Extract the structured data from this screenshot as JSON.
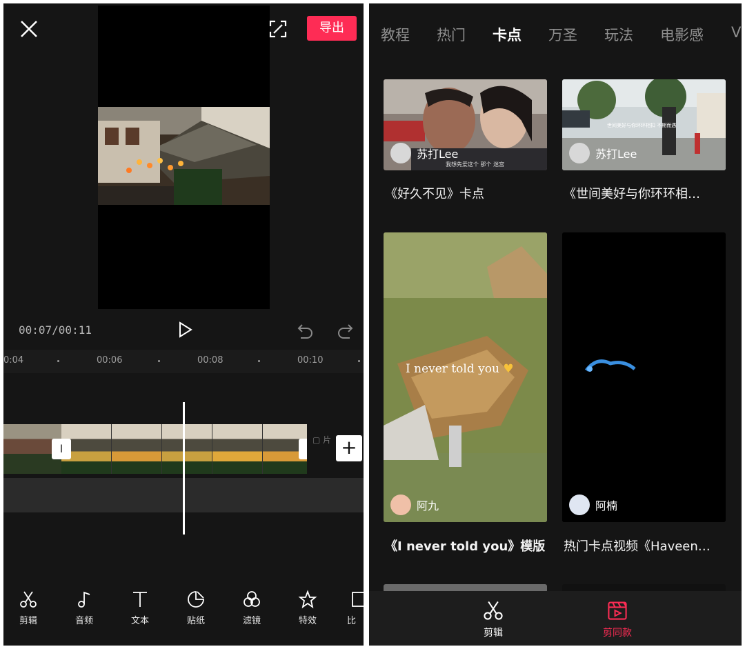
{
  "editor": {
    "export_label": "导出",
    "time": "00:07/00:11",
    "ruler": [
      "0:04",
      "00:06",
      "00:08",
      "00:10"
    ],
    "partial_label": "片",
    "tools": [
      {
        "label": "剪辑",
        "icon": "scissors-icon"
      },
      {
        "label": "音频",
        "icon": "music-note-icon"
      },
      {
        "label": "文本",
        "icon": "text-icon"
      },
      {
        "label": "贴纸",
        "icon": "sticker-icon"
      },
      {
        "label": "滤镜",
        "icon": "filter-icon"
      },
      {
        "label": "特效",
        "icon": "effects-star-icon"
      },
      {
        "label": "比",
        "icon": "ratio-icon"
      }
    ]
  },
  "templates": {
    "tabs": [
      "教程",
      "热门",
      "卡点",
      "万圣",
      "玩法",
      "电影感",
      "V"
    ],
    "active_tab": "卡点",
    "cards": [
      {
        "author": "苏打Lee",
        "title": "《好久不见》卡点",
        "caption": "我想先爱这个 那个 迷宫"
      },
      {
        "author": "苏打Lee",
        "title": "《世间美好与你环环相…",
        "caption": "世间美好与你环环相扣 不期而遇"
      },
      {
        "author": "阿九",
        "title": "《I never told you》模版",
        "overlay": "I never told you"
      },
      {
        "author": "阿楠",
        "title": "热门卡点视频《Haveen…"
      }
    ],
    "bottom_nav": [
      {
        "label": "剪辑",
        "icon": "scissors-icon"
      },
      {
        "label": "剪同款",
        "icon": "clapperboard-icon"
      }
    ],
    "accent": "#fe2c55"
  }
}
